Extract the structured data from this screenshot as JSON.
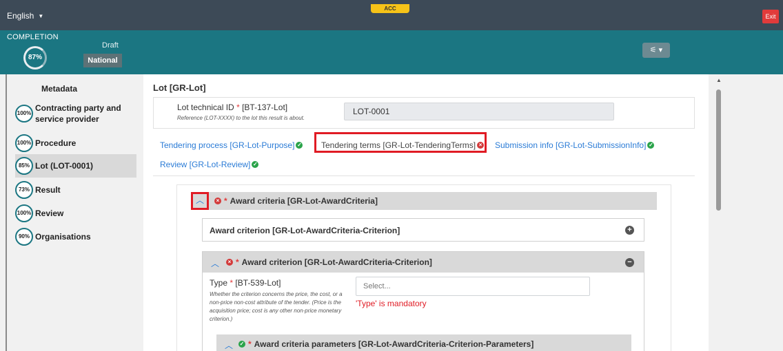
{
  "topbar": {
    "language": "English",
    "env_badge": "ACC",
    "exit_label": "Exit"
  },
  "completion": {
    "label": "COMPLETION",
    "percent": "87%",
    "status": "Draft",
    "scope": "National",
    "settings_icon": "sliders-icon"
  },
  "sidebar": {
    "title": "Metadata",
    "items": [
      {
        "percent": "100%",
        "label": "Contracting party and service provider"
      },
      {
        "percent": "100%",
        "label": "Procedure"
      },
      {
        "percent": "85%",
        "label": "Lot (LOT-0001)"
      },
      {
        "percent": "73%",
        "label": "Result"
      },
      {
        "percent": "100%",
        "label": "Review"
      },
      {
        "percent": "90%",
        "label": "Organisations"
      }
    ]
  },
  "main": {
    "title": "Lot [GR-Lot]",
    "technical_id": {
      "label": "Lot technical ID",
      "code": "[BT-137-Lot]",
      "hint": "Reference (LOT-XXXX) to the lot this result is about.",
      "value": "LOT-0001"
    },
    "tabs": [
      {
        "label": "Tendering process  [GR-Lot-Purpose]",
        "status": "ok"
      },
      {
        "label": "Tendering terms  [GR-Lot-TenderingTerms]",
        "status": "error"
      },
      {
        "label": "Submission info  [GR-Lot-SubmissionInfo]",
        "status": "ok"
      },
      {
        "label": "Review  [GR-Lot-Review]",
        "status": "ok"
      }
    ],
    "award_criteria": {
      "title": "Award criteria  [GR-Lot-AwardCriteria]",
      "collapsed_criterion": "Award criterion  [GR-Lot-AwardCriteria-Criterion]",
      "open_criterion": "Award criterion  [GR-Lot-AwardCriteria-Criterion]",
      "type_field": {
        "label": "Type",
        "code": "[BT-539-Lot]",
        "hint": "Whether the criterion concerns the price, the cost, or a non-price non-cost attribute of the tender. (Price is the acquisition price; cost is any other non-price monetary criterion.)",
        "placeholder": "Select...",
        "error": "'Type' is mandatory"
      },
      "parameters": "Award criteria parameters  [GR-Lot-AwardCriteria-Criterion-Parameters]"
    }
  },
  "colors": {
    "topbar": "#3d4a57",
    "band": "#1b7682",
    "link": "#2a7bd6",
    "error": "#e01b24",
    "ok": "#2aa34a"
  }
}
